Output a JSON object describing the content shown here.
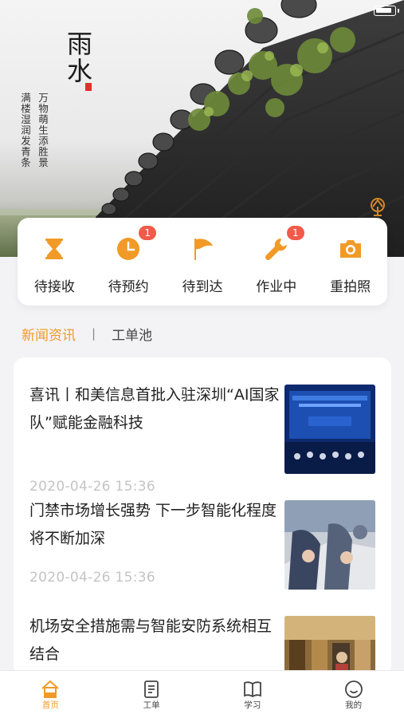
{
  "banner": {
    "title": "雨水",
    "poem_line1": "万物萌生添胜景",
    "poem_line2": "满楼湿润发青条"
  },
  "categories": [
    {
      "label": "待接收",
      "icon": "hourglass-icon",
      "badge": ""
    },
    {
      "label": "待预约",
      "icon": "clock-icon",
      "badge": "1"
    },
    {
      "label": "待到达",
      "icon": "flag-icon",
      "badge": ""
    },
    {
      "label": "作业中",
      "icon": "wrench-icon",
      "badge": "1"
    },
    {
      "label": "重拍照",
      "icon": "camera-icon",
      "badge": ""
    }
  ],
  "tabs": {
    "news": "新闻资讯",
    "separator": "|",
    "pool": "工单池"
  },
  "news": [
    {
      "title": "喜讯丨和美信息首批入驻深圳“AI国家队”赋能金融科技",
      "time": "2020-04-26 15:36",
      "thumb": "ceremony-photo"
    },
    {
      "title": "门禁市场增长强势 下一步智能化程度将不断加深",
      "time": "2020-04-26 15:36",
      "thumb": "meeting-photo"
    },
    {
      "title": "机场安全措施需与智能安防系统相互结合",
      "time": "",
      "thumb": "airport-photo"
    }
  ],
  "nav": [
    {
      "label": "首页",
      "icon": "home-icon",
      "active": true
    },
    {
      "label": "工单",
      "icon": "work-order-icon",
      "active": false
    },
    {
      "label": "学习",
      "icon": "book-icon",
      "active": false
    },
    {
      "label": "我的",
      "icon": "profile-icon",
      "active": false
    }
  ],
  "colors": {
    "accent": "#f19a27",
    "badge": "#f25a4a",
    "background": "#f3f3f6"
  }
}
